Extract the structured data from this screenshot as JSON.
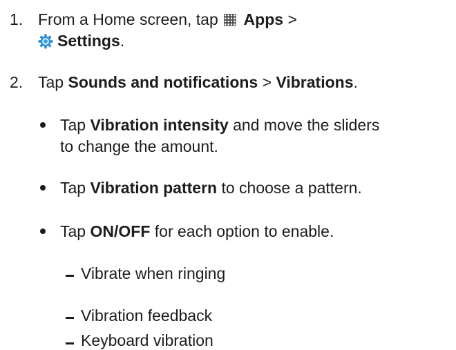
{
  "steps": [
    {
      "number": "1.",
      "line1_prefix": "From a Home screen, tap",
      "apps_label": "Apps",
      "apps_suffix": ">",
      "settings_label": "Settings",
      "settings_suffix": "."
    },
    {
      "number": "2.",
      "prefix": "Tap",
      "sounds_label": "Sounds and notifications",
      "sep": ">",
      "vibrations_label": "Vibrations",
      "suffix": "."
    }
  ],
  "bullets": [
    {
      "prefix": "Tap",
      "bold": "Vibration intensity",
      "rest": "and move the sliders",
      "line2": "to change the amount."
    },
    {
      "prefix": "Tap",
      "bold": "Vibration pattern",
      "rest": "to choose a pattern."
    },
    {
      "prefix": "Tap",
      "bold": "ON/OFF",
      "rest": "for each option to enable."
    }
  ],
  "sub_items": [
    "Vibrate when ringing",
    "Vibration feedback",
    "Keyboard vibration"
  ],
  "icons": {
    "apps": "apps-grid-icon",
    "settings": "settings-gear-icon",
    "gear_outer": "#2f8fd8",
    "gear_inner": "#ffffff",
    "gear_center": "#3aa0e6"
  }
}
